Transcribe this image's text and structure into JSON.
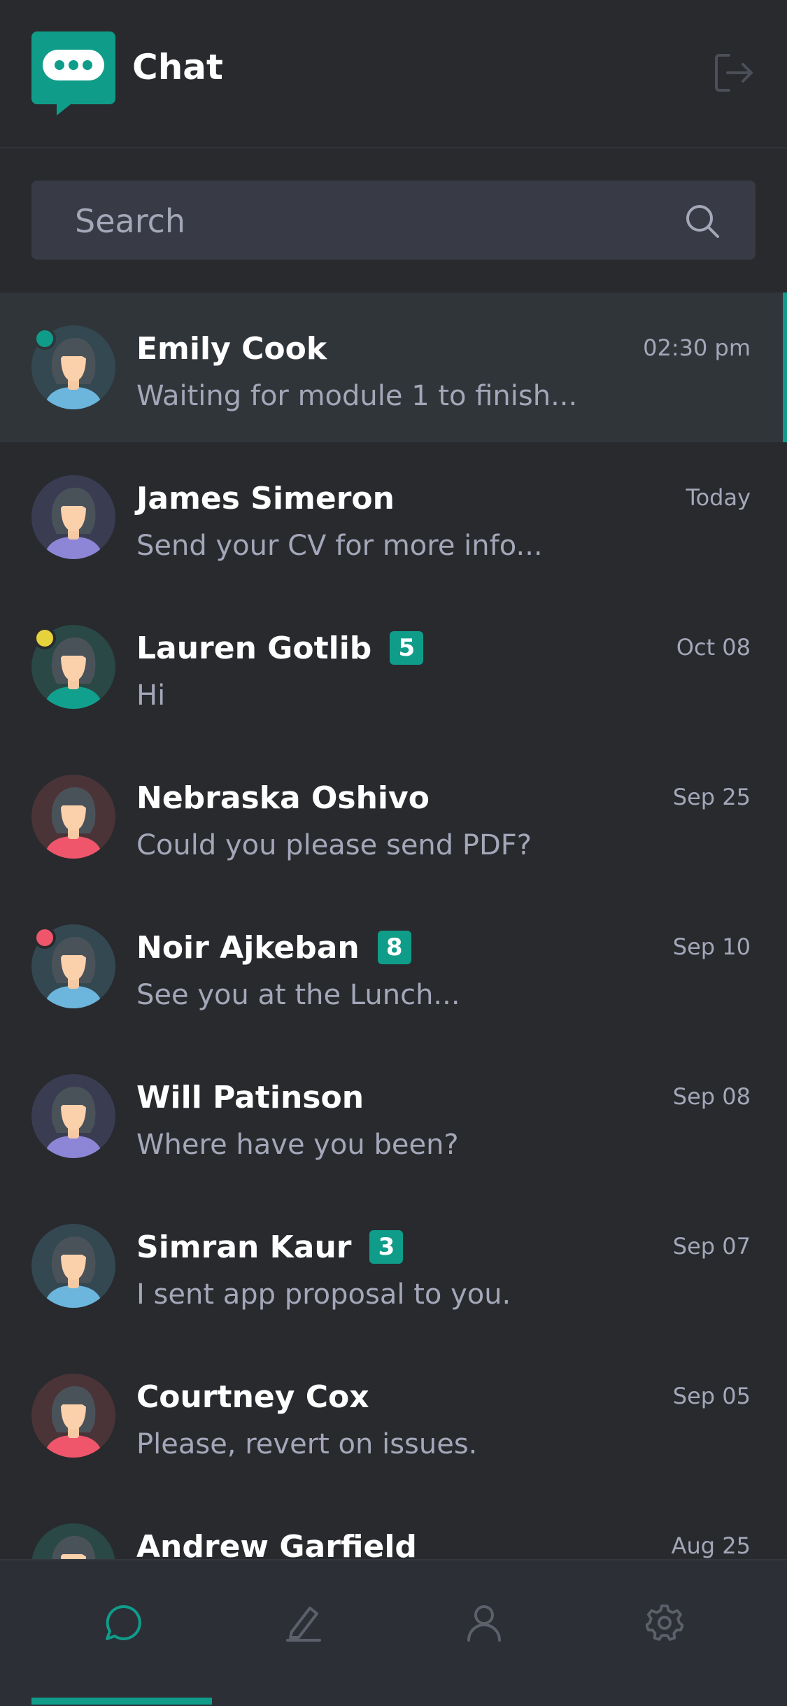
{
  "app": {
    "title": "Chat",
    "accent": "#0f9d8a"
  },
  "icons": {
    "logo": "chat-bubble-dots-icon",
    "logout": "logout-icon",
    "search": "search-icon"
  },
  "search": {
    "placeholder": "Search",
    "value": ""
  },
  "conversations": [
    {
      "name": "Emily Cook",
      "preview": "Waiting for module 1 to finish...",
      "time": "02:30 pm",
      "badge": "",
      "status": "#0f9d8a",
      "avatar_bg": "#344852",
      "avatar_body": "#6cb6de",
      "active": true
    },
    {
      "name": "James Simeron",
      "preview": "Send your CV for more info...",
      "time": "Today",
      "badge": "",
      "status": "",
      "avatar_bg": "#3a3d52",
      "avatar_body": "#8d86d6",
      "active": false
    },
    {
      "name": "Lauren Gotlib",
      "preview": "Hi",
      "time": "Oct 08",
      "badge": "5",
      "status": "#e6d33c",
      "avatar_bg": "#2a4845",
      "avatar_body": "#12a08e",
      "active": false
    },
    {
      "name": "Nebraska Oshivo",
      "preview": "Could you please send PDF?",
      "time": "Sep 25",
      "badge": "",
      "status": "",
      "avatar_bg": "#4a3438",
      "avatar_body": "#f0566b",
      "active": false
    },
    {
      "name": "Noir Ajkeban",
      "preview": "See you at the Lunch...",
      "time": "Sep 10",
      "badge": "8",
      "status": "#f0566b",
      "avatar_bg": "#344852",
      "avatar_body": "#6cb6de",
      "active": false
    },
    {
      "name": "Will Patinson",
      "preview": "Where have you been?",
      "time": "Sep 08",
      "badge": "",
      "status": "",
      "avatar_bg": "#3a3d52",
      "avatar_body": "#8d86d6",
      "active": false
    },
    {
      "name": "Simran Kaur",
      "preview": "I sent app proposal to you.",
      "time": "Sep 07",
      "badge": "3",
      "status": "",
      "avatar_bg": "#344852",
      "avatar_body": "#6cb6de",
      "active": false
    },
    {
      "name": "Courtney Cox",
      "preview": "Please, revert on issues.",
      "time": "Sep 05",
      "badge": "",
      "status": "",
      "avatar_bg": "#4a3438",
      "avatar_body": "#f0566b",
      "active": false
    },
    {
      "name": "Andrew Garfield",
      "preview": "",
      "time": "Aug 25",
      "badge": "",
      "status": "",
      "avatar_bg": "#2a4845",
      "avatar_body": "#12a08e",
      "active": false
    }
  ],
  "tabs": [
    {
      "icon": "chat-icon",
      "active": true
    },
    {
      "icon": "compose-icon",
      "active": false
    },
    {
      "icon": "profile-icon",
      "active": false
    },
    {
      "icon": "settings-icon",
      "active": false
    }
  ]
}
